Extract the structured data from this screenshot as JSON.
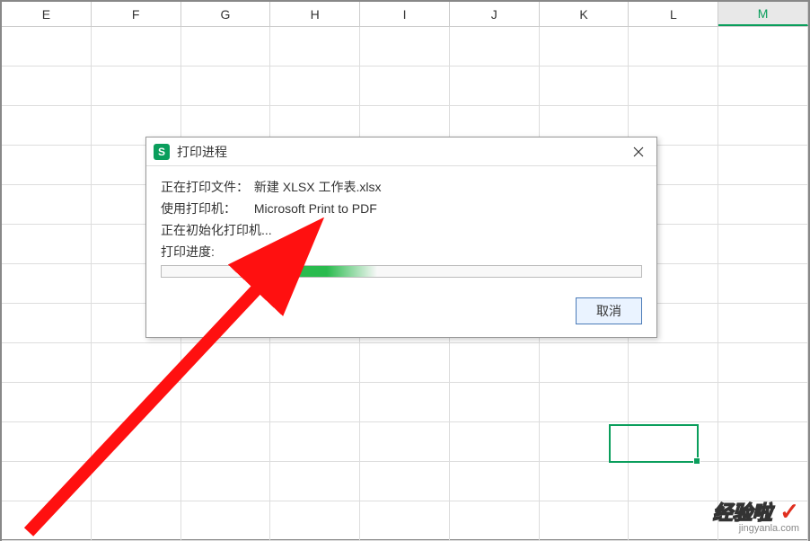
{
  "columns": [
    "E",
    "F",
    "G",
    "H",
    "I",
    "J",
    "K",
    "L",
    "M"
  ],
  "selected_column_index": 8,
  "dialog": {
    "title": "打印进程",
    "rows": {
      "file_label": "正在打印文件：",
      "file_value": "新建 XLSX 工作表.xlsx",
      "printer_label": "使用打印机：",
      "printer_value": "Microsoft Print to PDF",
      "init_text": "正在初始化打印机...",
      "progress_label": "打印进度:"
    },
    "cancel_label": "取消"
  },
  "watermark": {
    "main": "经验啦",
    "sub": "jingyanla.com"
  }
}
